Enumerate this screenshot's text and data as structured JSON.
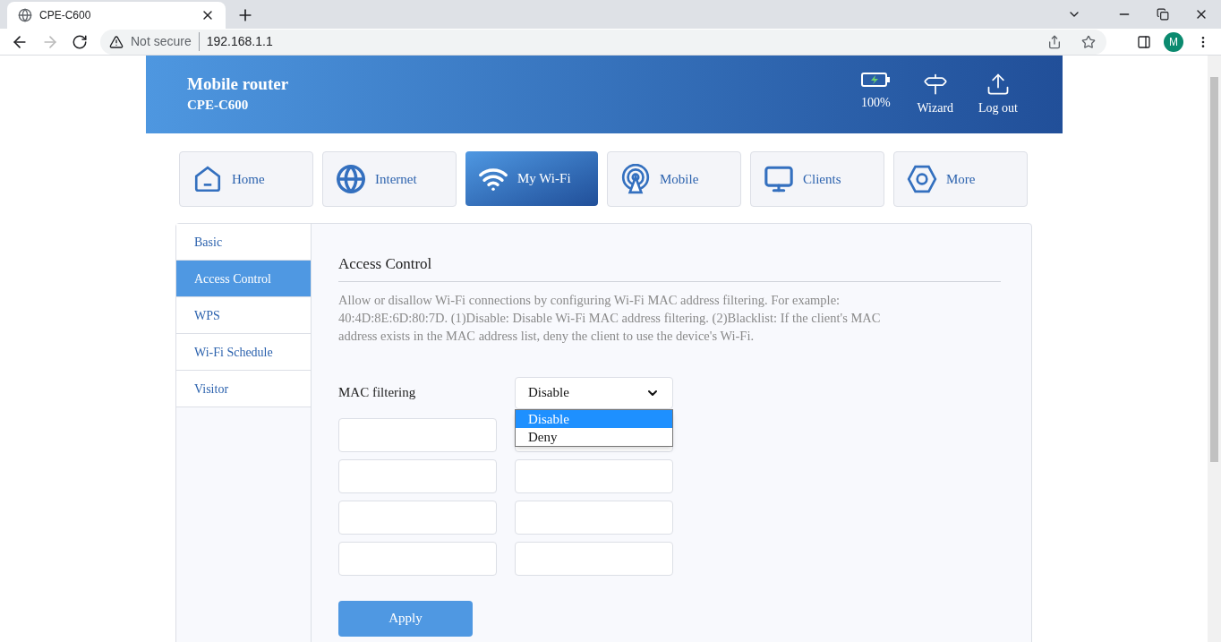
{
  "browser": {
    "tab_title": "CPE-C600",
    "security": "Not secure",
    "url": "192.168.1.1",
    "profile_initial": "M"
  },
  "header": {
    "title": "Mobile router",
    "model": "CPE-C600",
    "battery": "100%",
    "actions": [
      {
        "label": "Wizard"
      },
      {
        "label": "Log out"
      }
    ]
  },
  "nav_tabs": [
    {
      "label": "Home",
      "selected": false
    },
    {
      "label": "Internet",
      "selected": false
    },
    {
      "label": "My Wi-Fi",
      "selected": true
    },
    {
      "label": "Mobile",
      "selected": false
    },
    {
      "label": "Clients",
      "selected": false
    },
    {
      "label": "More",
      "selected": false
    }
  ],
  "sidebar": {
    "items": [
      {
        "label": "Basic",
        "selected": false
      },
      {
        "label": "Access Control",
        "selected": true
      },
      {
        "label": "WPS",
        "selected": false
      },
      {
        "label": "Wi-Fi Schedule",
        "selected": false
      },
      {
        "label": "Visitor",
        "selected": false
      }
    ]
  },
  "content": {
    "heading": "Access Control",
    "description": "Allow or disallow Wi-Fi connections by configuring Wi-Fi MAC address filtering. For example: 40:4D:8E:6D:80:7D. (1)Disable: Disable Wi-Fi MAC address filtering. (2)Blacklist: If the client's MAC address exists in the MAC address list, deny the client to use the device's Wi-Fi.",
    "mac_filtering": {
      "label": "MAC filtering",
      "value": "Disable",
      "expanded": true,
      "options": [
        {
          "label": "Disable",
          "selected": true
        },
        {
          "label": "Deny",
          "selected": false
        }
      ]
    },
    "apply_button": "Apply"
  }
}
